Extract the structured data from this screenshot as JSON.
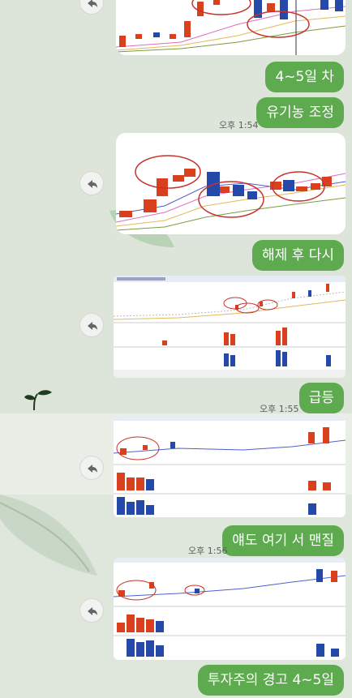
{
  "messages": [
    {
      "type": "image",
      "desc": "chart-1-partial"
    },
    {
      "type": "text",
      "text": "4~5일 차"
    },
    {
      "type": "text",
      "text": "유기농 조정"
    },
    {
      "type": "time",
      "text": "오후 1:54"
    },
    {
      "type": "image",
      "desc": "chart-2"
    },
    {
      "type": "text",
      "text": "해제 후 다시"
    },
    {
      "type": "image",
      "desc": "chart-3"
    },
    {
      "type": "text",
      "text": "급등"
    },
    {
      "type": "time",
      "text": "오후 1:55"
    },
    {
      "type": "image",
      "desc": "chart-4"
    },
    {
      "type": "text",
      "text": "얘도 여기 서 맨질"
    },
    {
      "type": "time",
      "text": "오후 1:56"
    },
    {
      "type": "image",
      "desc": "chart-5"
    },
    {
      "type": "text",
      "text": "투자주의 경고 4~5일"
    }
  ],
  "theme": {
    "bubble_color": "#5eaa4f",
    "up_color": "#d9401e",
    "down_color": "#2449a8"
  },
  "icons": {
    "share": "share-icon",
    "sprout": "sprout-icon"
  }
}
